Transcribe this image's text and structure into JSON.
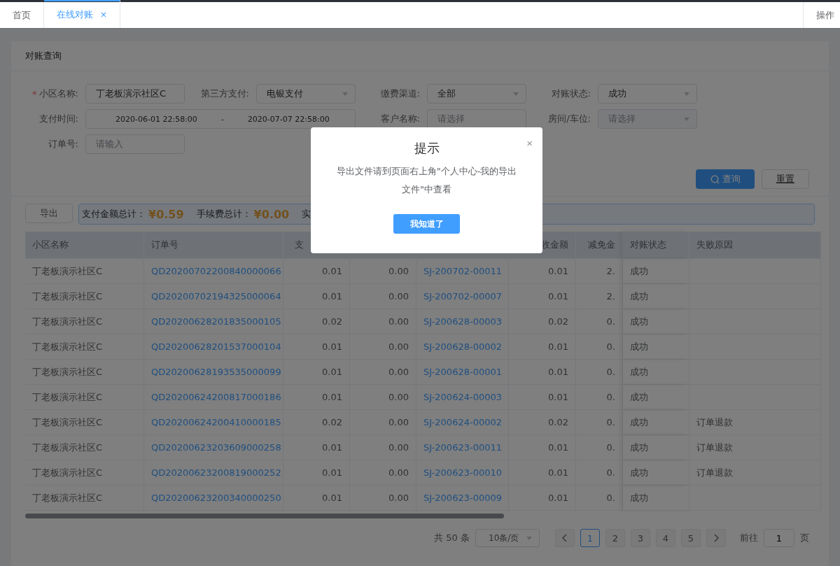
{
  "tabs": [
    {
      "label": "首页",
      "selected": false,
      "closable": false
    },
    {
      "label": "在线对账",
      "selected": true,
      "closable": true,
      "close": "×"
    }
  ],
  "tab_action": "操作",
  "panel_title": "对账查询",
  "required_mark": "*",
  "form": [
    {
      "label": "小区名称:",
      "required": true,
      "kind": "text",
      "value": "丁老板演示社区C"
    },
    {
      "label": "第三方支付:",
      "required": false,
      "kind": "select",
      "value": "电银支付"
    },
    {
      "label": "缴费渠道:",
      "required": false,
      "kind": "select",
      "value": "全部"
    },
    {
      "label": "对账状态:",
      "required": false,
      "kind": "select",
      "value": "成功"
    },
    {
      "label": "支付时间:",
      "required": false,
      "kind": "daterange",
      "start": "2020-06-01 22:58:00",
      "separator": "-",
      "end": "2020-07-07 22:58:00"
    },
    {
      "label": "客户名称:",
      "required": false,
      "kind": "text",
      "placeholder": "请选择"
    },
    {
      "label": "房间/车位:",
      "required": false,
      "kind": "select",
      "placeholder": "请选择"
    },
    {
      "label": "订单号:",
      "required": false,
      "kind": "text",
      "placeholder": "请输入"
    }
  ],
  "buttons": {
    "query": "查询",
    "reset": "重置"
  },
  "export_button": "导出",
  "summary": [
    {
      "label": "支付金额总计：",
      "value": "¥0.59"
    },
    {
      "label": "手续费总计：",
      "value": "¥0.00"
    },
    {
      "label": "实"
    }
  ],
  "table": {
    "columns": [
      {
        "label": "小区名称"
      },
      {
        "label": "订单号"
      },
      {
        "label": "支"
      },
      {},
      {},
      {
        "label": "收金额"
      },
      {
        "label": "减免金"
      },
      {
        "label": "对账状态"
      },
      {
        "label": "失败原因"
      }
    ],
    "rows": [
      {
        "community": "丁老板演示社区C",
        "order_no": "QD20200702200840000066",
        "column_3": "0.01",
        "column_4": "0.00",
        "column_5": "SJ-200702-00011",
        "column_6": "0.01",
        "column_7": "2.",
        "status": "成功"
      },
      {
        "community": "丁老板演示社区C",
        "order_no": "QD20200702194325000064",
        "column_3": "0.01",
        "column_4": "0.00",
        "column_5": "SJ-200702-00007",
        "column_6": "0.01",
        "column_7": "2.",
        "status": "成功"
      },
      {
        "community": "丁老板演示社区C",
        "order_no": "QD20200628201835000105",
        "column_3": "0.02",
        "column_4": "0.00",
        "column_5": "SJ-200628-00003",
        "column_6": "0.02",
        "column_7": "0.",
        "status": "成功"
      },
      {
        "community": "丁老板演示社区C",
        "order_no": "QD20200628201537000104",
        "column_3": "0.01",
        "column_4": "0.00",
        "column_5": "SJ-200628-00002",
        "column_6": "0.01",
        "column_7": "0.",
        "status": "成功"
      },
      {
        "community": "丁老板演示社区C",
        "order_no": "QD20200628193535000099",
        "column_3": "0.01",
        "column_4": "0.00",
        "column_5": "SJ-200628-00001",
        "column_6": "0.01",
        "column_7": "0.",
        "status": "成功"
      },
      {
        "community": "丁老板演示社区C",
        "order_no": "QD20200624200817000186",
        "column_3": "0.01",
        "column_4": "0.00",
        "column_5": "SJ-200624-00003",
        "column_6": "0.01",
        "column_7": "0.",
        "status": "成功"
      },
      {
        "community": "丁老板演示社区C",
        "order_no": "QD20200624200410000185",
        "column_3": "0.02",
        "column_4": "0.00",
        "column_5": "SJ-200624-00002",
        "column_6": "0.02",
        "column_7": "0.",
        "status": "成功",
        "reason": "订单退款"
      },
      {
        "community": "丁老板演示社区C",
        "order_no": "QD20200623203609000258",
        "column_3": "0.01",
        "column_4": "0.00",
        "column_5": "SJ-200623-00011",
        "column_6": "0.01",
        "column_7": "0.",
        "status": "成功",
        "reason": "订单退款"
      },
      {
        "community": "丁老板演示社区C",
        "order_no": "QD20200623200819000252",
        "column_3": "0.01",
        "column_4": "0.00",
        "column_5": "SJ-200623-00010",
        "column_6": "0.01",
        "column_7": "0.",
        "status": "成功",
        "reason": "订单退款"
      },
      {
        "community": "丁老板演示社区C",
        "order_no": "QD20200623200340000250",
        "column_3": "0.01",
        "column_4": "0.00",
        "column_5": "SJ-200623-00009",
        "column_6": "0.01",
        "column_7": "0.",
        "status": "成功"
      }
    ]
  },
  "pagination": {
    "total": "共 50 条",
    "page_size": "10条/页",
    "pages": [
      {
        "label": "1",
        "selected": true
      },
      {
        "label": "2",
        "selected": false
      },
      {
        "label": "3",
        "selected": false
      },
      {
        "label": "4",
        "selected": false
      },
      {
        "label": "5",
        "selected": false
      }
    ],
    "goto_label": "前往",
    "goto_value": "1",
    "goto_suffix": "页"
  },
  "dialog": {
    "title": "提示",
    "close": "×",
    "message": "导出文件请到页面右上角\"个人中心-我的导出文件\"中查看",
    "button": "我知道了"
  }
}
